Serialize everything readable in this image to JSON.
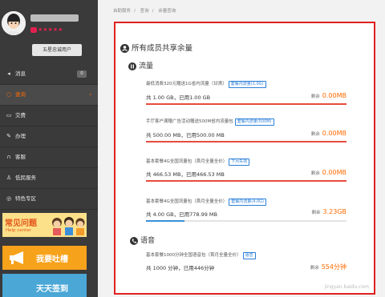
{
  "sidebar": {
    "username": "**********",
    "stars": "★★★★★",
    "member_label": "五星忠诚用户",
    "items": [
      {
        "label": "消息",
        "icon": "bell-icon",
        "count": "0"
      },
      {
        "label": "查询",
        "icon": "search-icon",
        "active": true
      },
      {
        "label": "交费",
        "icon": "payment-icon"
      },
      {
        "label": "办理",
        "icon": "edit-icon"
      },
      {
        "label": "客服",
        "icon": "headset-icon"
      },
      {
        "label": "低民服务",
        "icon": "service-icon"
      },
      {
        "label": "特色专区",
        "icon": "special-icon"
      }
    ],
    "banners": [
      {
        "title": "常见问题",
        "subtitle": "Help center"
      },
      {
        "title": "我要吐槽"
      },
      {
        "title": "天天签到"
      }
    ]
  },
  "breadcrumb": [
    "自助服务",
    "查询",
    "余量查询"
  ],
  "main": {
    "section_title": "所有成员共享余量",
    "flow": {
      "title": "流量",
      "items": [
        {
          "name": "最低消费320元赠送1G省内流量（甘肃）",
          "tag": "套餐内流量(1.0G)",
          "total": "共 1.00 GB",
          "used": "已用1.00 GB",
          "remain_label": "剩余",
          "remain": "0.00MB",
          "percent": 100
        },
        {
          "name": "手厅客户满赠广告活动赠送500M省内流量包",
          "tag": "套餐内流量(500M)",
          "total": "共 500.00 MB",
          "used": "已用500.00 MB",
          "remain_label": "剩余",
          "remain": "0.00MB",
          "percent": 100
        },
        {
          "name": "基本套餐4G全国流量包（首月全量全价）",
          "tag": "下月失效",
          "total": "共 466.53 MB",
          "used": "已用466.53 MB",
          "remain_label": "剩余",
          "remain": "0.00MB",
          "percent": 100
        },
        {
          "name": "基本套餐4G全国流量包（首月全量全价）",
          "tag": "套餐内流量(4.0G)",
          "total": "共 4.00 GB",
          "used": "已用778.99 MB",
          "remain_label": "剩余",
          "remain": "3.23GB",
          "percent": 19
        }
      ]
    },
    "voice": {
      "title": "语音",
      "items": [
        {
          "name": "基本套餐1000分钟全国语音包（首月全量全价）",
          "tag": "语音",
          "total": "共 1000 分钟",
          "used": "已用446分钟",
          "remain_label": "剩余",
          "remain": "554分钟"
        }
      ]
    },
    "watermark": "jingyan.baidu.com"
  },
  "colors": {
    "accent": "#ff6a00",
    "highlight_border": "#e02020",
    "tag": "#2b7fd8"
  }
}
